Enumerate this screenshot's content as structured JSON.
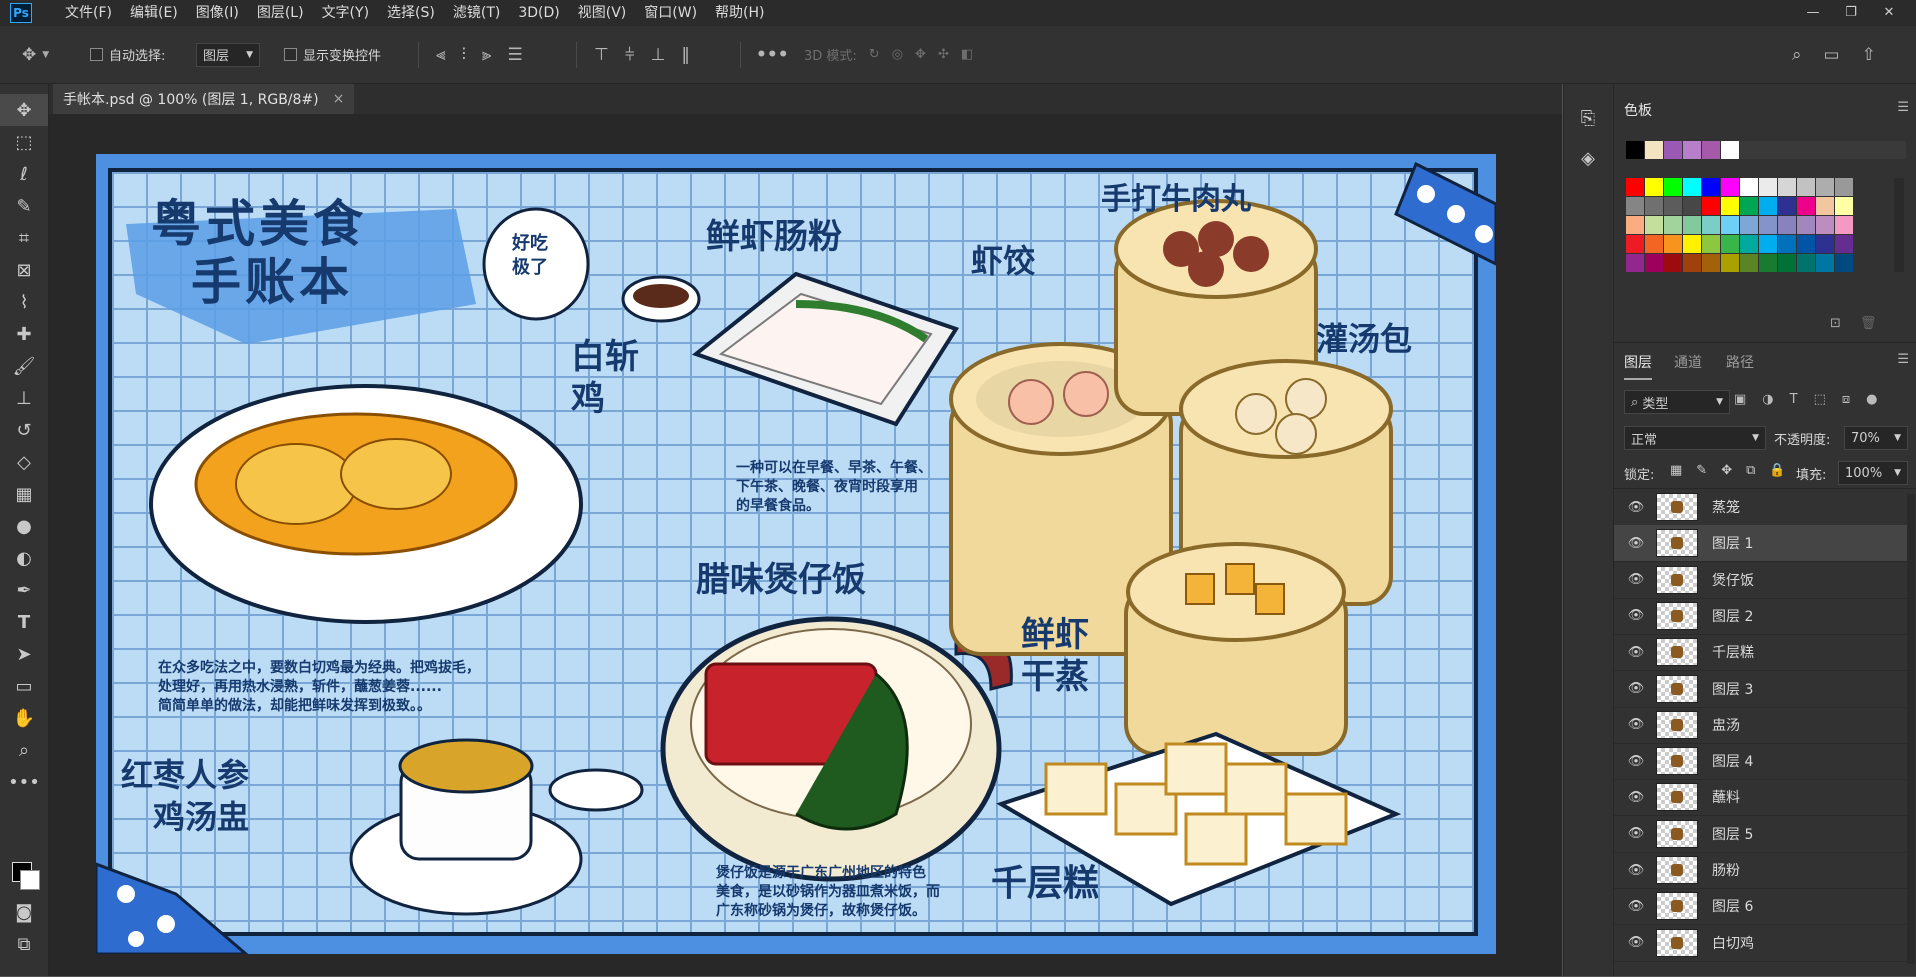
{
  "app": {
    "logo": "Ps"
  },
  "menu": [
    "文件(F)",
    "编辑(E)",
    "图像(I)",
    "图层(L)",
    "文字(Y)",
    "选择(S)",
    "滤镜(T)",
    "3D(D)",
    "视图(V)",
    "窗口(W)",
    "帮助(H)"
  ],
  "window_controls": [
    "—",
    "❐",
    "✕"
  ],
  "options": {
    "auto_select_label": "自动选择:",
    "auto_select_value": "图层",
    "show_transform_label": "显示变换控件",
    "mode3d_label": "3D 模式:"
  },
  "document": {
    "tab_title": "手帐本.psd @ 100% (图层 1, RGB/8#)",
    "close": "×"
  },
  "artwork": {
    "main_title_1": "粤式美食",
    "main_title_2": "手账本",
    "bubble": "好吃\n极了",
    "t_changfen": "鲜虾肠粉",
    "t_baiqieji": "白斩\n鸡",
    "t_xiajiao": "虾饺",
    "t_niurou": "手打牛肉丸",
    "t_guantang": "灌汤包",
    "t_baozai": "腊味煲仔饭",
    "t_ganzheng": "鲜虾\n干蒸",
    "t_qianceng": "千层糕",
    "t_jitang": "红枣人参\n鸡汤盅",
    "desc_zaocha": "一种可以在早餐、早茶、午餐、\n下午茶、晚餐、夜宵时段享用\n的早餐食品。",
    "desc_ji": "在众多吃法之中，要数白切鸡最为经典。把鸡拔毛，\n处理好，再用热水浸熟，斩件，蘸葱姜蓉......\n简简单单的做法，却能把鲜味发挥到极致。。",
    "desc_baozai": "煲仔饭是源于广东广州地区的特色\n美食，是以砂锅作为器皿煮米饭，而\n广东称砂锅为煲仔，故称煲仔饭。"
  },
  "panels": {
    "swatches_tab": "色板",
    "recent_colors": [
      "#000000",
      "#f4e3c0",
      "#9b59b6",
      "#b77fc9",
      "#a45aa8",
      "#ffffff"
    ],
    "swatch_colors": [
      [
        "#ff0000",
        "#ffff00",
        "#00ff00",
        "#00ffff",
        "#0000ff",
        "#ff00ff",
        "#ffffff",
        "#ebebeb",
        "#d6d6d6",
        "#c2c2c2",
        "#adadad",
        "#999999"
      ],
      [
        "#858585",
        "#707070",
        "#5c5c5c",
        "#474747",
        "#ff0000",
        "#ffff00",
        "#00a651",
        "#00aeef",
        "#2e3192",
        "#ec008c",
        "#f2c7a0",
        "#ffffa6"
      ],
      [
        "#f9ad81",
        "#c4df9b",
        "#a2d39c",
        "#82ca9d",
        "#7bcdc8",
        "#6ecff6",
        "#7ea7d8",
        "#8493ca",
        "#8882be",
        "#a187be",
        "#bc8dbf",
        "#f49ac2"
      ],
      [
        "#ed1c24",
        "#f26522",
        "#f7941d",
        "#fff200",
        "#8dc63f",
        "#39b54a",
        "#00a99d",
        "#00aeef",
        "#0072bc",
        "#0054a6",
        "#2e3192",
        "#662d91"
      ],
      [
        "#92278f",
        "#9e005d",
        "#9e0b0f",
        "#a0410d",
        "#a36209",
        "#aba000",
        "#598527",
        "#197b30",
        "#007236",
        "#00746b",
        "#0076a3",
        "#004a80"
      ]
    ],
    "layer_tabs": [
      "图层",
      "通道",
      "路径"
    ],
    "filter_kind": "类型",
    "blend_mode": "正常",
    "opacity_label": "不透明度:",
    "opacity_value": "70%",
    "lock_label": "锁定:",
    "fill_label": "填充:",
    "fill_value": "100%",
    "layers": [
      "蒸笼",
      "图层 1",
      "煲仔饭",
      "图层 2",
      "千层糕",
      "图层 3",
      "盅汤",
      "图层 4",
      "蘸料",
      "图层 5",
      "肠粉",
      "图层 6",
      "白切鸡"
    ],
    "selected_layer": "图层 1"
  }
}
